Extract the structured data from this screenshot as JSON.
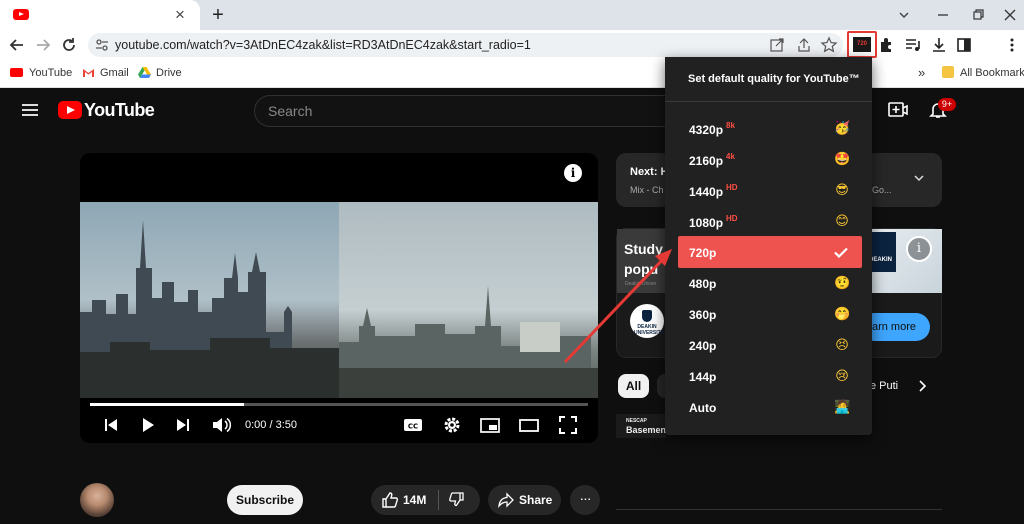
{
  "browser": {
    "tab_close": "×",
    "new_tab": "+",
    "url": "youtube.com/watch?v=3AtDnEC4zak&list=RD3AtDnEC4zak&start_radio=1",
    "extension_badge": "720",
    "bookmarks": [
      "YouTube",
      "Gmail",
      "Drive"
    ],
    "more_bookmarks": "»",
    "all_bookmarks": "All Bookmarks"
  },
  "youtube": {
    "logo_text": "YouTube",
    "search_placeholder": "Search",
    "notification_count": "9+"
  },
  "player": {
    "time": "0:00 / 3:50",
    "progress_fraction": 0.31
  },
  "sidebar": {
    "next_label": "Next: H",
    "next_sub": "Mix - Ch",
    "next_sub_right": "Go...",
    "ad_title_1": "Study",
    "ad_title_2": "popu",
    "ad_small": "Deakin Univer",
    "deakin": "DEAKIN UNIVERSITY",
    "deakin_short": "DEAKIN",
    "learn_more": "arn more",
    "chip_all": "All",
    "chip_putin": "e Puti",
    "rec_line1": "NESCAP",
    "rec_line2": "Basemen"
  },
  "actions": {
    "subscribe": "Subscribe",
    "likes": "14M",
    "share": "Share",
    "more": "···"
  },
  "quality_menu": {
    "title": "Set default quality for YouTube™",
    "options": [
      {
        "label": "4320p",
        "sup": "8k",
        "icon": "party-face-icon",
        "glyph": "🥳"
      },
      {
        "label": "2160p",
        "sup": "4k",
        "icon": "star-struck-icon",
        "glyph": "🤩"
      },
      {
        "label": "1440p",
        "sup": "HD",
        "icon": "sunglasses-face-icon",
        "glyph": "😎"
      },
      {
        "label": "1080p",
        "sup": "HD",
        "icon": "smiling-face-icon",
        "glyph": "😊"
      },
      {
        "label": "720p",
        "sup": "",
        "icon": "check-icon",
        "glyph": "",
        "selected": true
      },
      {
        "label": "480p",
        "sup": "",
        "icon": "raised-eyebrow-face-icon",
        "glyph": "🤨"
      },
      {
        "label": "360p",
        "sup": "",
        "icon": "shushing-face-icon",
        "glyph": "🤭"
      },
      {
        "label": "240p",
        "sup": "",
        "icon": "persevering-face-icon",
        "glyph": "😣"
      },
      {
        "label": "144p",
        "sup": "",
        "icon": "crying-face-icon",
        "glyph": "😢"
      },
      {
        "label": "Auto",
        "sup": "",
        "icon": "person-at-laptop-icon",
        "glyph": "🧑‍💻"
      }
    ]
  },
  "colors": {
    "youtube_red": "#ff0000",
    "menu_selected": "#ef5350",
    "annotation": "#e53935",
    "sup_text": "#ff4e45"
  }
}
